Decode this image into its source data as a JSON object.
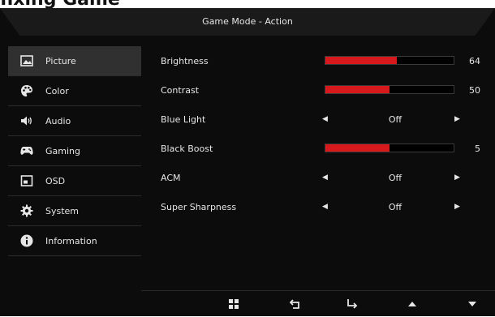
{
  "page_heading": "fixing Game",
  "header": {
    "title": "Game Mode - Action"
  },
  "sidebar": {
    "items": [
      {
        "label": "Picture",
        "icon": "picture-icon",
        "active": true
      },
      {
        "label": "Color",
        "icon": "palette-icon"
      },
      {
        "label": "Audio",
        "icon": "speaker-icon"
      },
      {
        "label": "Gaming",
        "icon": "gamepad-icon"
      },
      {
        "label": "OSD",
        "icon": "osd-window-icon"
      },
      {
        "label": "System",
        "icon": "gear-icon"
      },
      {
        "label": "Information",
        "icon": "info-icon"
      }
    ]
  },
  "settings": [
    {
      "label": "Brightness",
      "type": "slider",
      "value": "64",
      "fraction": 0.56
    },
    {
      "label": "Contrast",
      "type": "slider",
      "value": "50",
      "fraction": 0.5
    },
    {
      "label": "Blue Light",
      "type": "option",
      "value": "Off"
    },
    {
      "label": "Black Boost",
      "type": "slider",
      "value": "5",
      "fraction": 0.5
    },
    {
      "label": "ACM",
      "type": "option",
      "value": "Off"
    },
    {
      "label": "Super Sharpness",
      "type": "option",
      "value": "Off"
    }
  ],
  "footer": {
    "buttons": [
      "menu-grid-icon",
      "back-icon",
      "enter-icon",
      "up-icon",
      "down-icon"
    ]
  },
  "colors": {
    "accent": "#d7191e",
    "panel": "#0c0c0c",
    "header": "#1a1a1a"
  }
}
